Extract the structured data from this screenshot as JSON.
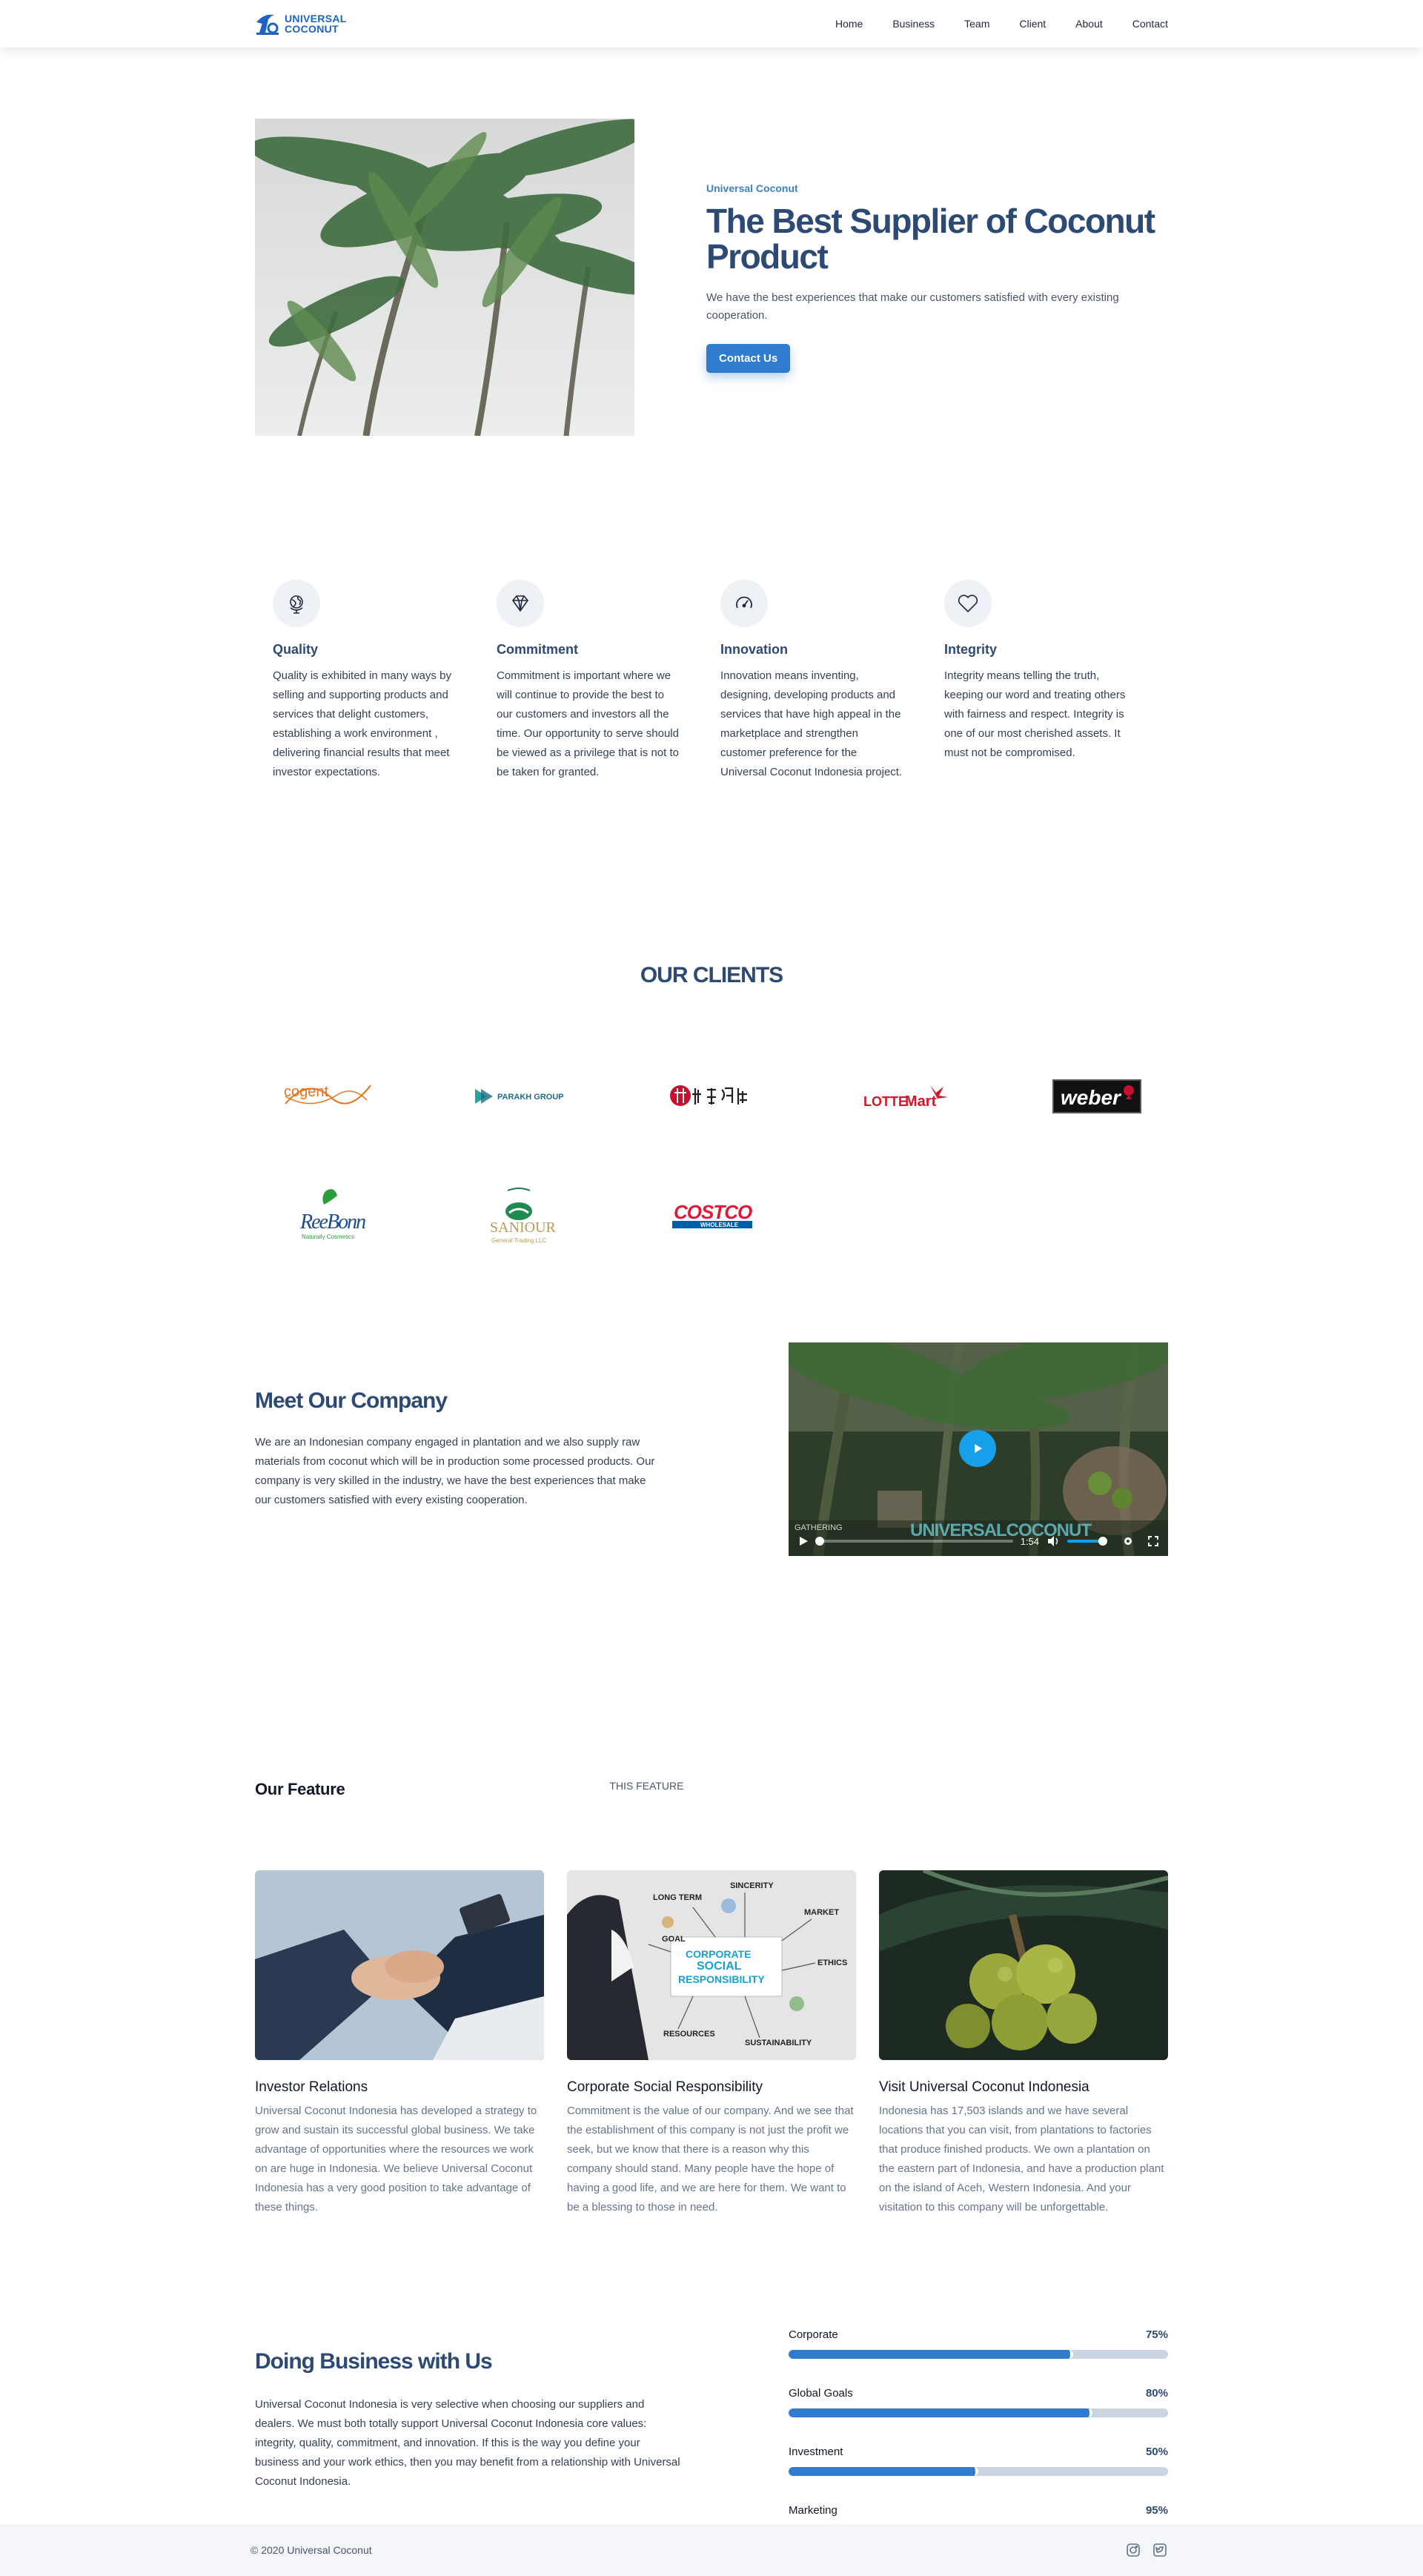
{
  "brand": {
    "line1": "UNIVERSAL",
    "line2": "COCONUT",
    "color": "#1d64c2"
  },
  "nav": [
    "Home",
    "Business",
    "Team",
    "Client",
    "About",
    "Contact"
  ],
  "hero": {
    "eyebrow": "Universal Coconut",
    "title": "The Best Supplier of Coconut Product",
    "description": "We have the best experiences that make our customers satisfied with every existing cooperation.",
    "cta": "Contact Us"
  },
  "values": [
    {
      "icon": "globe-icon",
      "title": "Quality",
      "text": "Quality is exhibited in many ways by selling and supporting products and services that delight customers, establishing a work environment , delivering financial results that meet investor expectations."
    },
    {
      "icon": "diamond-icon",
      "title": "Commitment",
      "text": "Commitment is important where we will continue to provide the best to our customers and investors all the time. Our opportunity to serve should be viewed as a privilege that is not to be taken for granted."
    },
    {
      "icon": "gauge-icon",
      "title": "Innovation",
      "text": "Innovation means inventing, designing, developing products and services that have high appeal in the marketplace and strengthen customer preference for the Universal Coconut Indonesia project."
    },
    {
      "icon": "heart-icon",
      "title": "Integrity",
      "text": "Integrity means telling the truth, keeping our word and treating others with fairness and respect. Integrity is one of our most cherished assets. It must not be compromised."
    }
  ],
  "clients": {
    "title": "OUR CLIENTS",
    "logos": {
      "cogent": "cogent",
      "parakh": "PARAKH GROUP",
      "lotte_a": "LOTTE",
      "lotte_b": "Mart",
      "weber": "weber",
      "reebonn": "ReeBonn",
      "reebonn_tag": "Naturally Cosmetics",
      "saniour": "SANIOUR",
      "saniour_tag": "General Trading LLC",
      "costco": "COSTCO",
      "costco_tag": "WHOLESALE"
    }
  },
  "meet": {
    "title": "Meet Our Company",
    "description": "We are an Indonesian company engaged in plantation and we also supply raw materials from coconut which will be in production some processed products. Our company is very skilled in the industry, we have the best experiences that make our customers satisfied with every existing cooperation.",
    "video": {
      "watermark": "UNIVERSALCOCONUT",
      "caption": "GATHERING",
      "time": "1:54"
    }
  },
  "feature": {
    "title": "Our Feature",
    "subtitle": "THIS FEATURE",
    "cards": [
      {
        "title": "Investor Relations",
        "text": "Universal Coconut Indonesia has developed a strategy to grow and sustain its successful global business. We take advantage of opportunities where the resources we work on are huge in Indonesia. We believe Universal Coconut Indonesia has a very good position to take advantage of these things."
      },
      {
        "title": "Corporate Social Responsibility",
        "text": "Commitment is the value of our company. And we see that the establishment of this company is not just the profit we seek, but we know that there is a reason why this company should stand. Many people have the hope of having a good life, and we are here for them. We want to be a blessing to those in need."
      },
      {
        "title": "Visit Universal Coconut Indonesia",
        "text": "Indonesia has 17,503 islands and we have several locations that you can visit, from plantations to factories that produce finished products. We own a plantation on the eastern part of Indonesia, and have a production plant on the island of Aceh, Western Indonesia. And your visitation to this company will be unforgettable."
      }
    ],
    "csr_words": [
      "LONG TERM",
      "SINCERITY",
      "MARKET",
      "GOAL",
      "CORPORATE",
      "SOCIAL",
      "RESPONSIBILITY",
      "ETHICS",
      "RESOURCES",
      "SUSTAINABILITY"
    ]
  },
  "business": {
    "title": "Doing Business with Us",
    "description": "Universal Coconut Indonesia is very selective when choosing our suppliers and dealers. We must both totally support Universal Coconut Indonesia core values: integrity, quality, commitment, and innovation. If this is the way you define your business and your work ethics, then you may benefit from a relationship with Universal Coconut Indonesia.",
    "bars": [
      {
        "label": "Corporate",
        "pct": "75%",
        "value": 75
      },
      {
        "label": "Global Goals",
        "pct": "80%",
        "value": 80
      },
      {
        "label": "Investment",
        "pct": "50%",
        "value": 50
      },
      {
        "label": "Marketing",
        "pct": "95%",
        "value": 95
      }
    ]
  },
  "footer": {
    "copyright": "© 2020 Universal Coconut",
    "social": [
      "instagram-icon",
      "twitter-icon"
    ]
  }
}
